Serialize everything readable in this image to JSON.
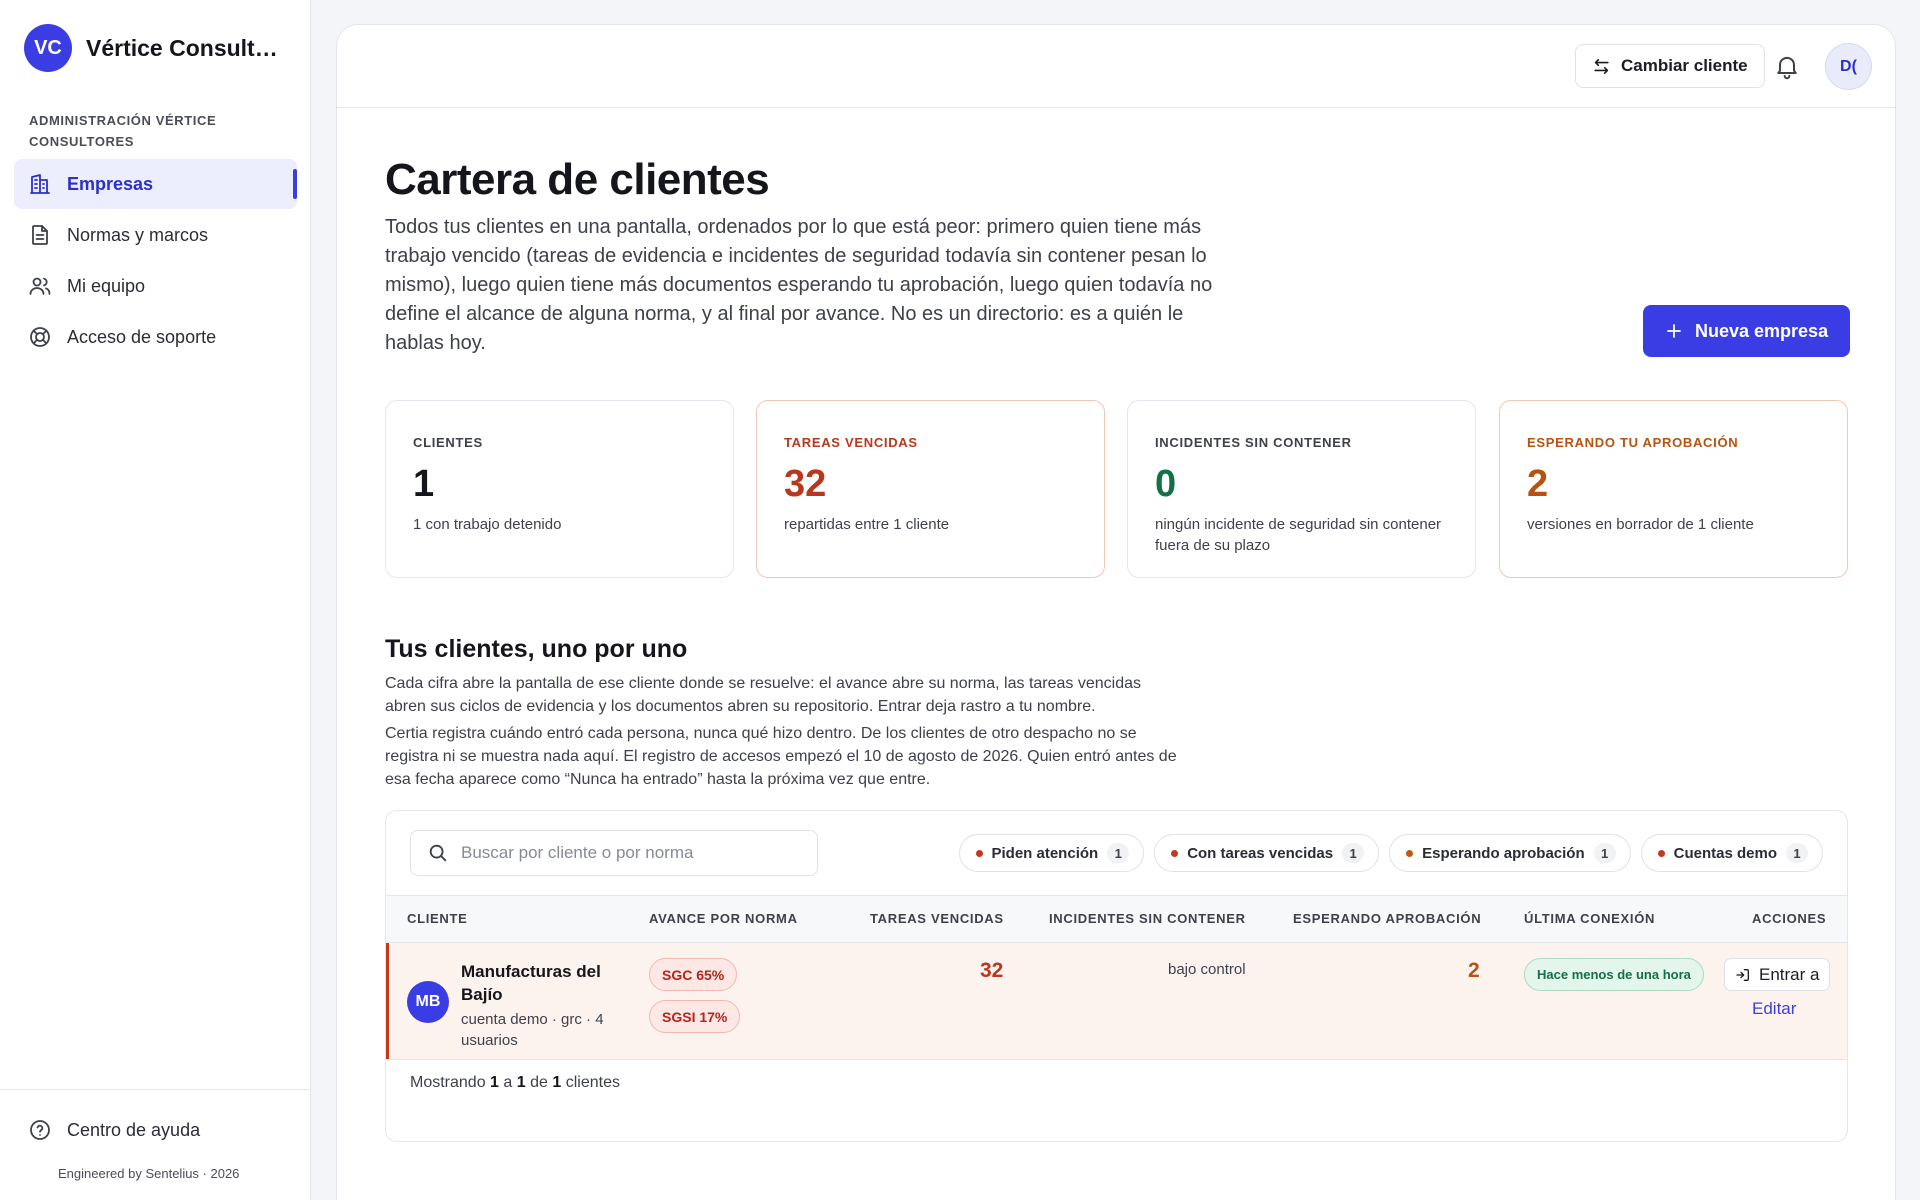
{
  "sidebar": {
    "brand_initials": "VC",
    "brand_name": "Vértice Consultores",
    "section_label": "Administración Vértice Consultores",
    "items": [
      {
        "label": "Empresas",
        "icon": "building-icon",
        "active": true
      },
      {
        "label": "Normas y marcos",
        "icon": "document-icon",
        "active": false
      },
      {
        "label": "Mi equipo",
        "icon": "users-icon",
        "active": false
      },
      {
        "label": "Acceso de soporte",
        "icon": "lifebuoy-icon",
        "active": false
      }
    ],
    "help_label": "Centro de ayuda",
    "credit": "Engineered by Sentelius · 2026"
  },
  "topbar": {
    "switch_client_label": "Cambiar cliente",
    "user_initials": "D("
  },
  "header": {
    "title": "Cartera de clientes",
    "description": "Todos tus clientes en una pantalla, ordenados por lo que está peor: primero quien tiene más trabajo vencido (tareas de evidencia e incidentes de seguridad todavía sin contener pesan lo mismo), luego quien tiene más documentos esperando tu aprobación, luego quien todavía no define el alcance de alguna norma, y al final por avance. No es un directorio: es a quién le hablas hoy.",
    "new_company_label": "Nueva empresa"
  },
  "stats": [
    {
      "label": "Clientes",
      "value": "1",
      "sub": "1 con trabajo detenido",
      "tone": "default"
    },
    {
      "label": "Tareas vencidas",
      "value": "32",
      "sub": "repartidas entre 1 cliente",
      "tone": "red"
    },
    {
      "label": "Incidentes sin contener",
      "value": "0",
      "sub": "ningún incidente de seguridad sin contener fuera de su plazo",
      "tone": "green"
    },
    {
      "label": "Esperando tu aprobación",
      "value": "2",
      "sub": "versiones en borrador de 1 cliente",
      "tone": "orange"
    }
  ],
  "clients_section": {
    "title": "Tus clientes, uno por uno",
    "desc1": "Cada cifra abre la pantalla de ese cliente donde se resuelve: el avance abre su norma, las tareas vencidas abren sus ciclos de evidencia y los documentos abren su repositorio. Entrar deja rastro a tu nombre.",
    "desc2": "Certia registra cuándo entró cada persona, nunca qué hizo dentro. De los clientes de otro despacho no se registra ni se muestra nada aquí. El registro de accesos empezó el 10 de agosto de 2026. Quien entró antes de esa fecha aparece como “Nunca ha entrado” hasta la próxima vez que entre."
  },
  "table": {
    "search_placeholder": "Buscar por cliente o por norma",
    "filters": [
      {
        "label": "Piden atención",
        "count": "1"
      },
      {
        "label": "Con tareas vencidas",
        "count": "1"
      },
      {
        "label": "Esperando aprobación",
        "count": "1"
      },
      {
        "label": "Cuentas demo",
        "count": "1"
      }
    ],
    "columns": [
      "Cliente",
      "Avance por norma",
      "Tareas vencidas",
      "Incidentes sin contener",
      "Esperando aprobación",
      "Última conexión",
      "Acciones"
    ],
    "rows": [
      {
        "initials": "MB",
        "name": "Manufacturas del Bajío",
        "meta": "cuenta demo · grc · 4 usuarios",
        "norms": [
          "SGC 65%",
          "SGSI 17%"
        ],
        "overdue": "32",
        "incidents": "bajo control",
        "awaiting": "2",
        "last_login": "Hace menos de una hora",
        "enter_label": "Entrar a",
        "edit_label": "Editar"
      }
    ],
    "footer": {
      "prefix": "Mostrando",
      "from": "1",
      "a": "a",
      "to": "1",
      "de": "de",
      "total": "1",
      "suffix": "clientes"
    }
  },
  "colors": {
    "accent": "#3a3de3",
    "danger": "#b8371d",
    "warning": "#b8520e",
    "success": "#137047"
  }
}
